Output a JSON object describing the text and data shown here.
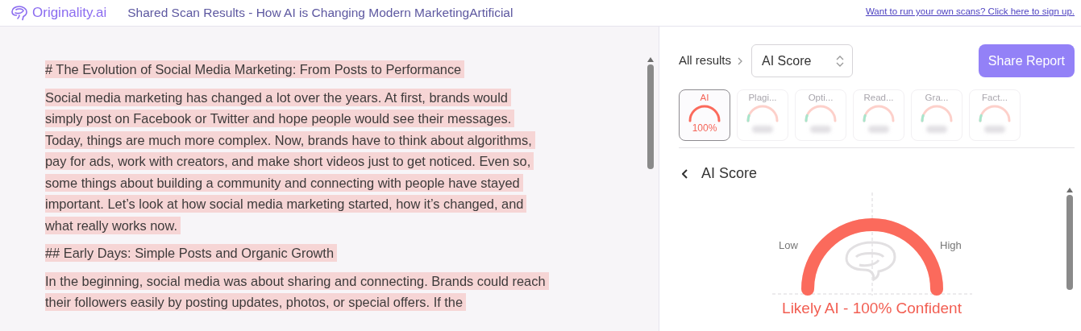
{
  "header": {
    "brand": "Originality.ai",
    "title": "Shared Scan Results - How AI is Changing Modern MarketingArtificial",
    "signup_link": "Want to run your own scans? Click here to sign up."
  },
  "document": {
    "blocks": [
      {
        "text": "# The Evolution of Social Media Marketing: From Posts to Performance",
        "highlighted": true
      },
      {
        "text": "Social media marketing has changed a lot over the years. At first, brands would simply post on Facebook or Twitter and hope people would see their messages. Today, things are much more complex. Now, brands have to think about algorithms, pay for ads, work with creators, and make short videos just to get noticed. Even so, some things about building a community and connecting with people have stayed important. Let’s look at how social media marketing started, how it’s changed, and what really works now.",
        "highlighted": true
      },
      {
        "text": "## Early Days: Simple Posts and Organic Growth",
        "highlighted": true
      },
      {
        "text": "In the beginning, social media was about sharing and connecting. Brands could reach their followers easily by posting updates, photos, or special offers. If the",
        "highlighted": true
      }
    ]
  },
  "results": {
    "breadcrumb": "All results",
    "view_select": "AI Score",
    "share_button": "Share Report",
    "tiles": [
      {
        "label": "AI",
        "value": "100%",
        "selected": true
      },
      {
        "label": "Plagi...",
        "selected": false
      },
      {
        "label": "Opti...",
        "selected": false
      },
      {
        "label": "Read...",
        "selected": false
      },
      {
        "label": "Gra...",
        "selected": false
      },
      {
        "label": "Fact...",
        "selected": false
      }
    ],
    "section_title": "AI Score",
    "gauge": {
      "level": 1,
      "low_label": "Low",
      "high_label": "High",
      "verdict": "Likely AI - 100% Confident"
    }
  }
}
